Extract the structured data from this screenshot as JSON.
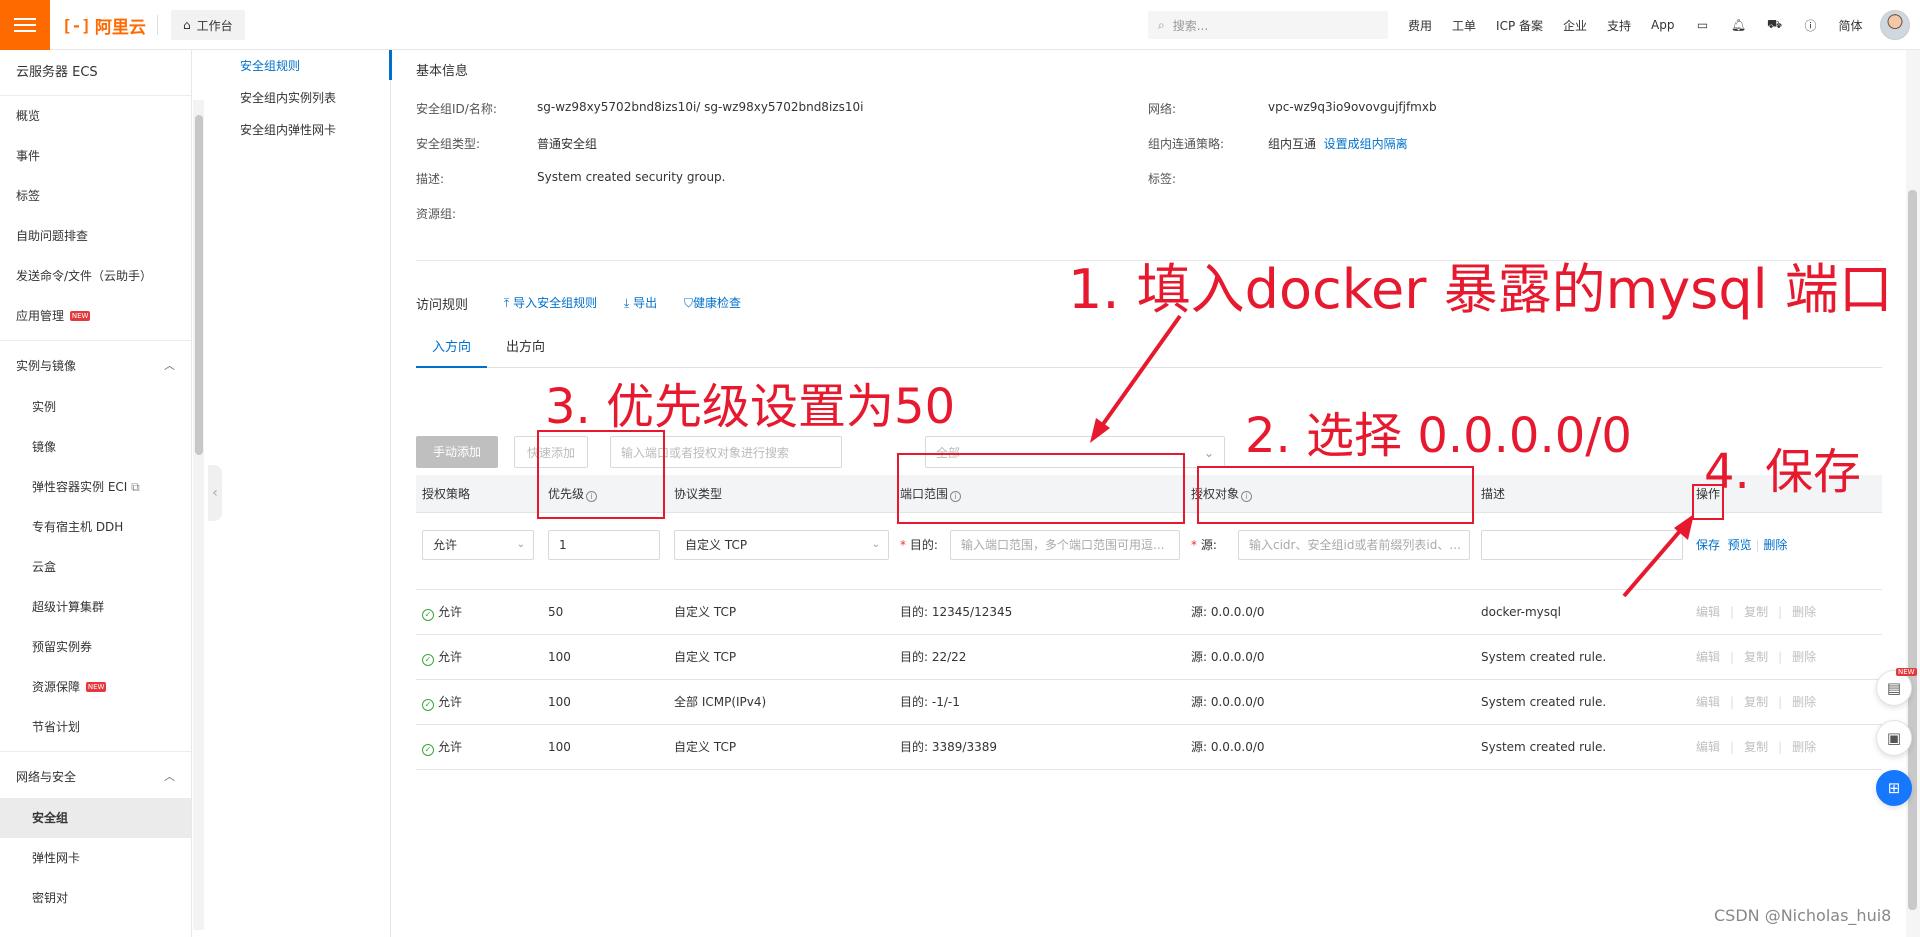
{
  "topbar": {
    "logo_text": "阿里云",
    "logo_mark": "[-]",
    "workbench": "工作台",
    "search_placeholder": "搜索...",
    "nav": [
      "费用",
      "工单",
      "ICP 备案",
      "企业",
      "支持",
      "App"
    ],
    "lang": "简体"
  },
  "sidebar": {
    "title": "云服务器 ECS",
    "items_top": [
      "概览",
      "事件",
      "标签",
      "自助问题排查",
      "发送命令/文件（云助手）",
      "应用管理"
    ],
    "new_badge": "NEW",
    "group1": "实例与镜像",
    "group1_items": [
      "实例",
      "镜像",
      "弹性容器实例 ECI",
      "专有宿主机 DDH",
      "云盒",
      "超级计算集群",
      "预留实例券",
      "资源保障",
      "节省计划"
    ],
    "group2": "网络与安全",
    "group2_items": [
      "安全组",
      "弹性网卡",
      "密钥对"
    ]
  },
  "subnav": [
    "安全组规则",
    "安全组内实例列表",
    "安全组内弹性网卡"
  ],
  "basic": {
    "title": "基本信息",
    "id_label": "安全组ID/名称:",
    "id_value": "sg-wz98xy5702bnd8izs10i/ sg-wz98xy5702bnd8izs10i",
    "network_label": "网络:",
    "network_value": "vpc-wz9q3io9ovovgujfjfmxb",
    "type_label": "安全组类型:",
    "type_value": "普通安全组",
    "policy_label": "组内连通策略:",
    "policy_value": "组内互通",
    "policy_link": "设置成组内隔离",
    "desc_label": "描述:",
    "desc_value": "System created security group.",
    "tag_label": "标签:",
    "rg_label": "资源组:"
  },
  "access": {
    "title": "访问规则",
    "import": "导入安全组规则",
    "export": "导出",
    "health": "健康检查",
    "tab_in": "入方向",
    "tab_out": "出方向",
    "btn_manual": "手动添加",
    "btn_quick": "快速添加",
    "filter_hint": "输入端口或者授权对象进行搜索",
    "filter_all": "全部"
  },
  "table": {
    "headers": [
      "授权策略",
      "优先级",
      "协议类型",
      "端口范围",
      "授权对象",
      "描述",
      "操作"
    ],
    "edit": {
      "policy": "允许",
      "priority": "1",
      "protocol": "自定义 TCP",
      "dest_label": "目的:",
      "dest_placeholder": "输入端口范围，多个端口范围可用逗...",
      "src_label": "源:",
      "src_placeholder": "输入cidr、安全组id或者前缀列表id、...",
      "save": "保存",
      "preview": "预览",
      "delete": "删除"
    },
    "rows": [
      {
        "policy": "允许",
        "priority": "50",
        "protocol": "自定义 TCP",
        "port": "目的: 12345/12345",
        "src": "源: 0.0.0.0/0",
        "desc": "docker-mysql"
      },
      {
        "policy": "允许",
        "priority": "100",
        "protocol": "自定义 TCP",
        "port": "目的: 22/22",
        "src": "源: 0.0.0.0/0",
        "desc": "System created rule."
      },
      {
        "policy": "允许",
        "priority": "100",
        "protocol": "全部 ICMP(IPv4)",
        "port": "目的: -1/-1",
        "src": "源: 0.0.0.0/0",
        "desc": "System created rule."
      },
      {
        "policy": "允许",
        "priority": "100",
        "protocol": "自定义 TCP",
        "port": "目的: 3389/3389",
        "src": "源: 0.0.0.0/0",
        "desc": "System created rule."
      }
    ],
    "ops": [
      "编辑",
      "复制",
      "删除"
    ]
  },
  "annotations": {
    "a1": "1. 填入docker 暴露的mysql 端口",
    "a2": "2. 选择 0.0.0.0/0",
    "a3": "3. 优先级设置为50",
    "a4": "4. 保存",
    "color": "#e6192e"
  },
  "watermark": "CSDN @Nicholas_hui8",
  "colors": {
    "brand": "#ff6a00",
    "link": "#0070cc",
    "success": "#36a839"
  }
}
